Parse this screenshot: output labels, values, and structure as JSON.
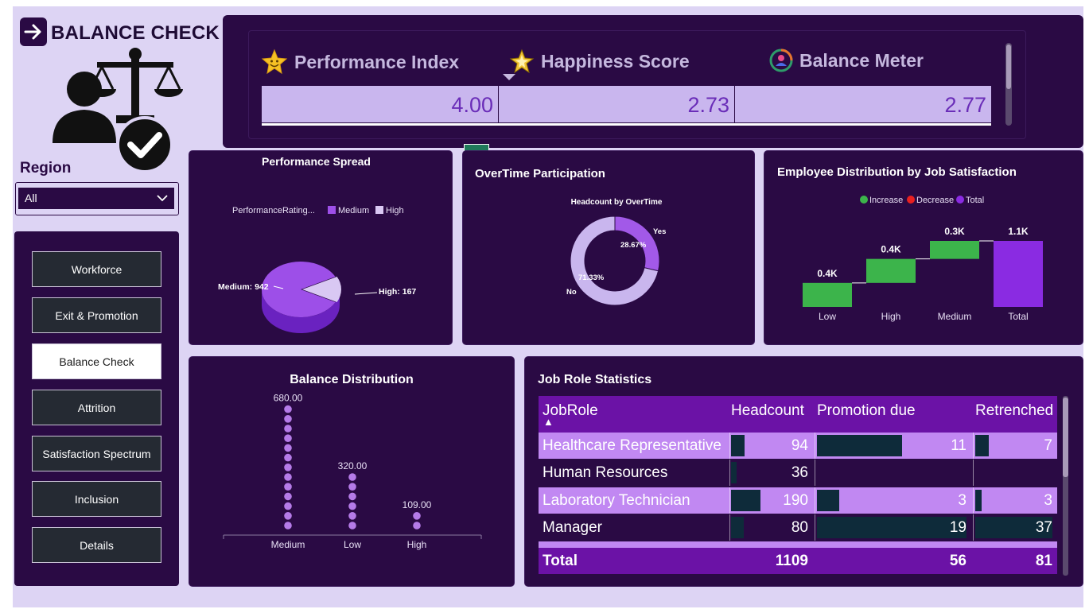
{
  "app": {
    "title": "BALANCE CHECK"
  },
  "region": {
    "label": "Region",
    "value": "All"
  },
  "nav": [
    "Workforce",
    "Exit & Promotion",
    "Balance Check",
    "Attrition",
    "Satisfaction Spectrum",
    "Inclusion",
    "Details"
  ],
  "nav_active": "Balance Check",
  "kpi": {
    "performance": {
      "label": "Performance Index",
      "value": "4.00"
    },
    "happiness": {
      "label": "Happiness Score",
      "value": "2.73"
    },
    "balance": {
      "label": "Balance Meter",
      "value": "2.77"
    }
  },
  "perf_spread": {
    "title": "Performance Spread",
    "chart_data": {
      "type": "pie",
      "legend_title": "PerformanceRating...",
      "categories": [
        "Medium",
        "High"
      ],
      "values": [
        942,
        167
      ],
      "labels": [
        "Medium: 942",
        "High: 167"
      ],
      "colors": [
        "#9d4fe8",
        "#d9c8f3"
      ],
      "legend": "top"
    }
  },
  "overtime": {
    "title": "OverTime Participation",
    "chart_data": {
      "type": "pie",
      "title": "Headcount by OverTime",
      "categories": [
        "Yes",
        "No"
      ],
      "values": [
        28.67,
        71.33
      ],
      "labels": [
        "28.67%",
        "71.33%"
      ],
      "colors": [
        "#a259e8",
        "#c9b6ee"
      ]
    }
  },
  "job_sat": {
    "title": "Employee Distribution by Job Satisfaction",
    "chart_data": {
      "type": "bar",
      "subtype": "waterfall",
      "legend": [
        "Increase",
        "Decrease",
        "Total"
      ],
      "legend_colors": [
        "#3cb44b",
        "#e82020",
        "#8a2be2"
      ],
      "categories": [
        "Low",
        "High",
        "Medium",
        "Total"
      ],
      "values": [
        0.4,
        0.4,
        0.3,
        1.1
      ],
      "labels": [
        "0.4K",
        "0.4K",
        "0.3K",
        "1.1K"
      ],
      "unit": "K"
    }
  },
  "balance_dist": {
    "title": "Balance Distribution",
    "chart_data": {
      "type": "scatter",
      "categories": [
        "Medium",
        "Low",
        "High"
      ],
      "values": [
        680,
        320,
        109
      ],
      "labels": [
        "680.00",
        "320.00",
        "109.00"
      ]
    }
  },
  "job_role": {
    "title": "Job Role Statistics",
    "columns": [
      "JobRole",
      "Headcount",
      "Promotion due",
      "Retrenched"
    ],
    "sort_glyph": "▲",
    "rows": [
      {
        "role": "Healthcare Representative",
        "headcount": "94",
        "promotion": "11",
        "retrenched": "7"
      },
      {
        "role": "Human Resources",
        "headcount": "36",
        "promotion": "",
        "retrenched": ""
      },
      {
        "role": "Laboratory Technician",
        "headcount": "190",
        "promotion": "3",
        "retrenched": "3"
      },
      {
        "role": "Manager",
        "headcount": "80",
        "promotion": "19",
        "retrenched": "37"
      }
    ],
    "total": {
      "label": "Total",
      "headcount": "1109",
      "promotion": "56",
      "retrenched": "81"
    },
    "bar_fractions": [
      {
        "headcount": 0.18,
        "promotion": 0.57,
        "retrenched": 0.18
      },
      {
        "headcount": 0.07,
        "promotion": 0,
        "retrenched": 0
      },
      {
        "headcount": 0.38,
        "promotion": 0.15,
        "retrenched": 0.08
      },
      {
        "headcount": 0.16,
        "promotion": 1.0,
        "retrenched": 1.0
      }
    ]
  }
}
